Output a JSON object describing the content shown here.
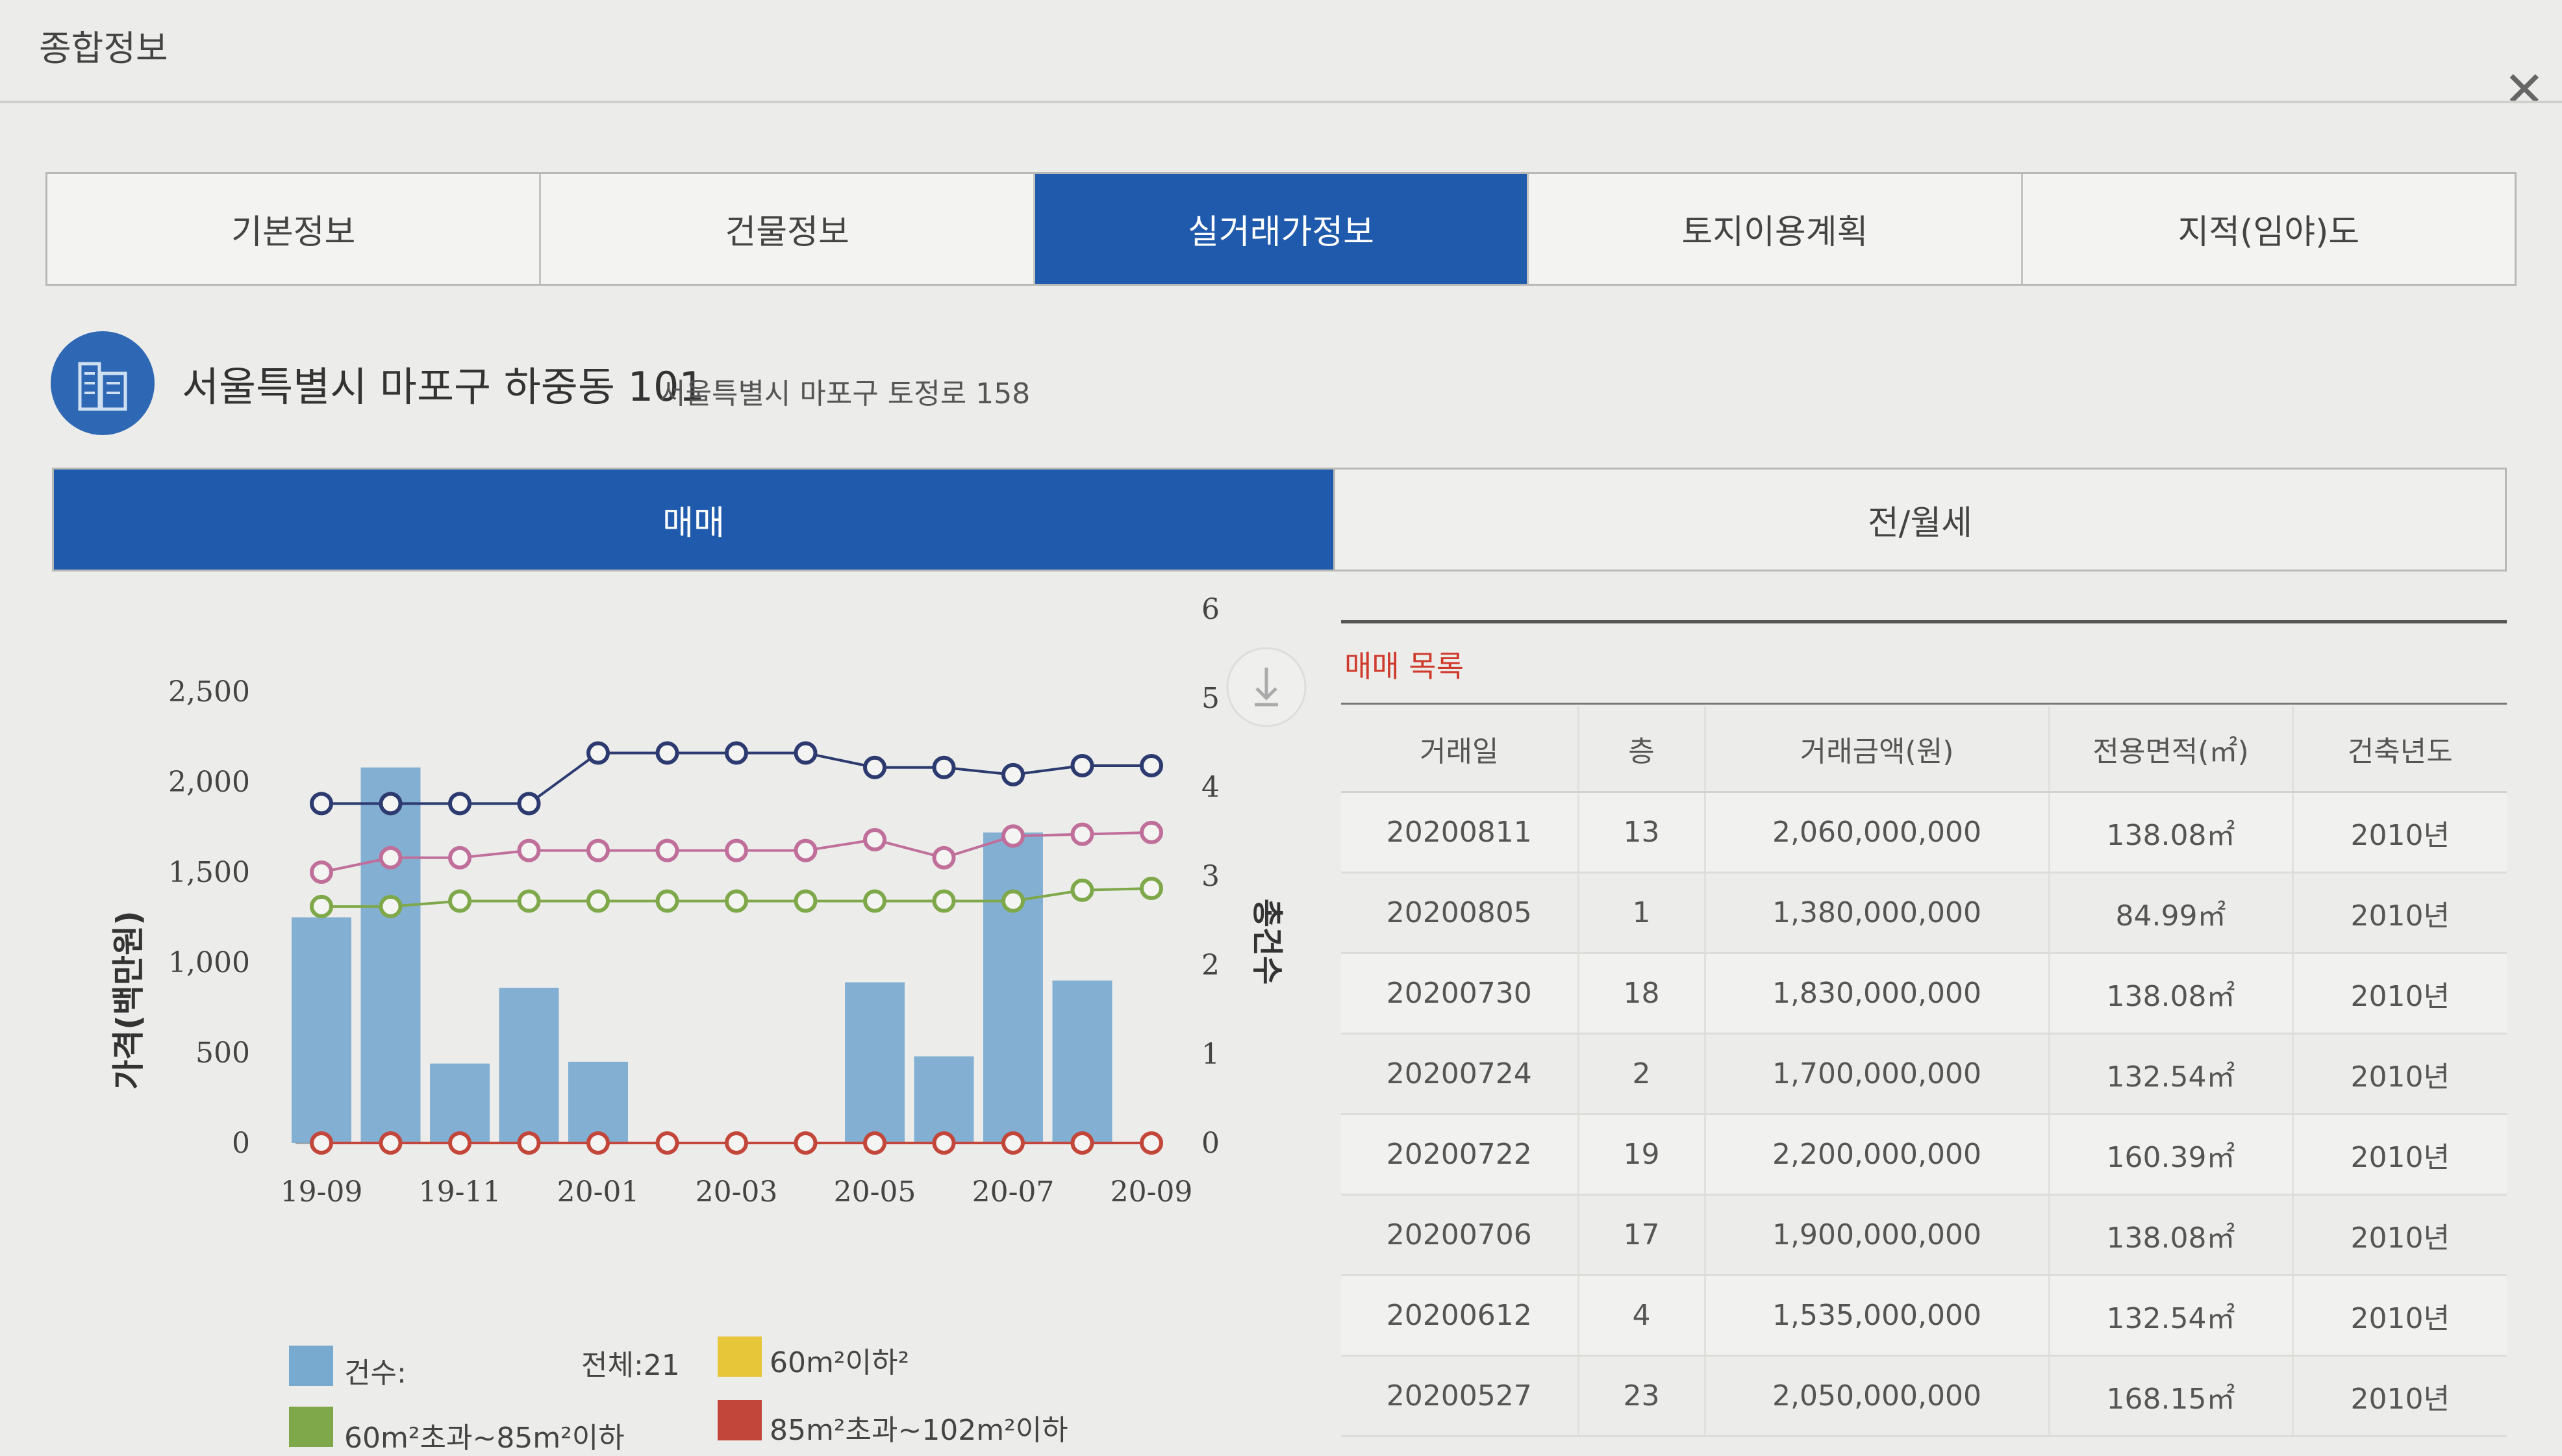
{
  "window": {
    "title": "종합정보"
  },
  "tabs": [
    "기본정보",
    "건물정보",
    "실거래가정보",
    "토지이용계획",
    "지적(임야)도"
  ],
  "address": {
    "main": "서울특별시 마포구 하중동 101",
    "sub": "서울특별시 마포구 토정로 158"
  },
  "subtabs": [
    "매매",
    "전/월세"
  ],
  "list": {
    "title": "매매 목록",
    "headers": [
      "거래일",
      "층",
      "거래금액(원)",
      "전용면적(㎡)",
      "건축년도"
    ],
    "rows": [
      [
        "20200811",
        "13",
        "2,060,000,000",
        "138.08㎡",
        "2010년"
      ],
      [
        "20200805",
        "1",
        "1,380,000,000",
        "84.99㎡",
        "2010년"
      ],
      [
        "20200730",
        "18",
        "1,830,000,000",
        "138.08㎡",
        "2010년"
      ],
      [
        "20200724",
        "2",
        "1,700,000,000",
        "132.54㎡",
        "2010년"
      ],
      [
        "20200722",
        "19",
        "2,200,000,000",
        "160.39㎡",
        "2010년"
      ],
      [
        "20200706",
        "17",
        "1,900,000,000",
        "138.08㎡",
        "2010년"
      ],
      [
        "20200612",
        "4",
        "1,535,000,000",
        "132.54㎡",
        "2010년"
      ],
      [
        "20200527",
        "23",
        "2,050,000,000",
        "168.15㎡",
        "2010년"
      ]
    ]
  },
  "legend": {
    "count_label": "건수:",
    "total": "전체:21",
    "s1": "60m²이하²",
    "s2": "60m²초과~85m²이하",
    "s3": "85m²초과~102m²이하"
  },
  "colors": {
    "accent": "#1f5aac",
    "bar": "#78a9cf",
    "navy": "#2c3a70",
    "pink": "#c06f9a",
    "green": "#7fa84a",
    "red": "#c3463a",
    "yellow": "#e7c63a"
  },
  "chart_data": {
    "type": "bar",
    "ylabel": "가격(백만원)",
    "y2label": "총건수",
    "ylim": [
      0,
      2500
    ],
    "y2lim": [
      0,
      6
    ],
    "yticks": [
      "0",
      "500",
      "1,000",
      "1,500",
      "2,000",
      "2,500"
    ],
    "y2ticks": [
      "0",
      "1",
      "2",
      "3",
      "4",
      "5",
      "6"
    ],
    "xtick_labels": [
      "19-09",
      "19-11",
      "20-01",
      "20-03",
      "20-05",
      "20-07",
      "20-09"
    ],
    "x": [
      "19-09",
      "19-10",
      "19-11",
      "19-12",
      "20-01",
      "20-02",
      "20-03",
      "20-04",
      "20-05",
      "20-06",
      "20-07",
      "20-08",
      "20-09"
    ],
    "bars": {
      "name": "건수:",
      "values": [
        1250,
        2080,
        440,
        860,
        450,
        0,
        0,
        0,
        890,
        480,
        1720,
        900,
        0
      ]
    },
    "lines": [
      {
        "color": "navy",
        "values": [
          1880,
          1880,
          1880,
          1880,
          2160,
          2160,
          2160,
          2160,
          2080,
          2080,
          2040,
          2090,
          2090
        ]
      },
      {
        "color": "pink",
        "values": [
          1500,
          1580,
          1580,
          1620,
          1620,
          1620,
          1620,
          1620,
          1680,
          1580,
          1700,
          1710,
          1720
        ]
      },
      {
        "color": "green",
        "values": [
          1310,
          1310,
          1340,
          1340,
          1340,
          1340,
          1340,
          1340,
          1340,
          1340,
          1340,
          1400,
          1410
        ]
      },
      {
        "color": "red",
        "values": [
          0,
          0,
          0,
          0,
          0,
          0,
          0,
          0,
          0,
          0,
          0,
          0,
          0
        ]
      }
    ]
  }
}
